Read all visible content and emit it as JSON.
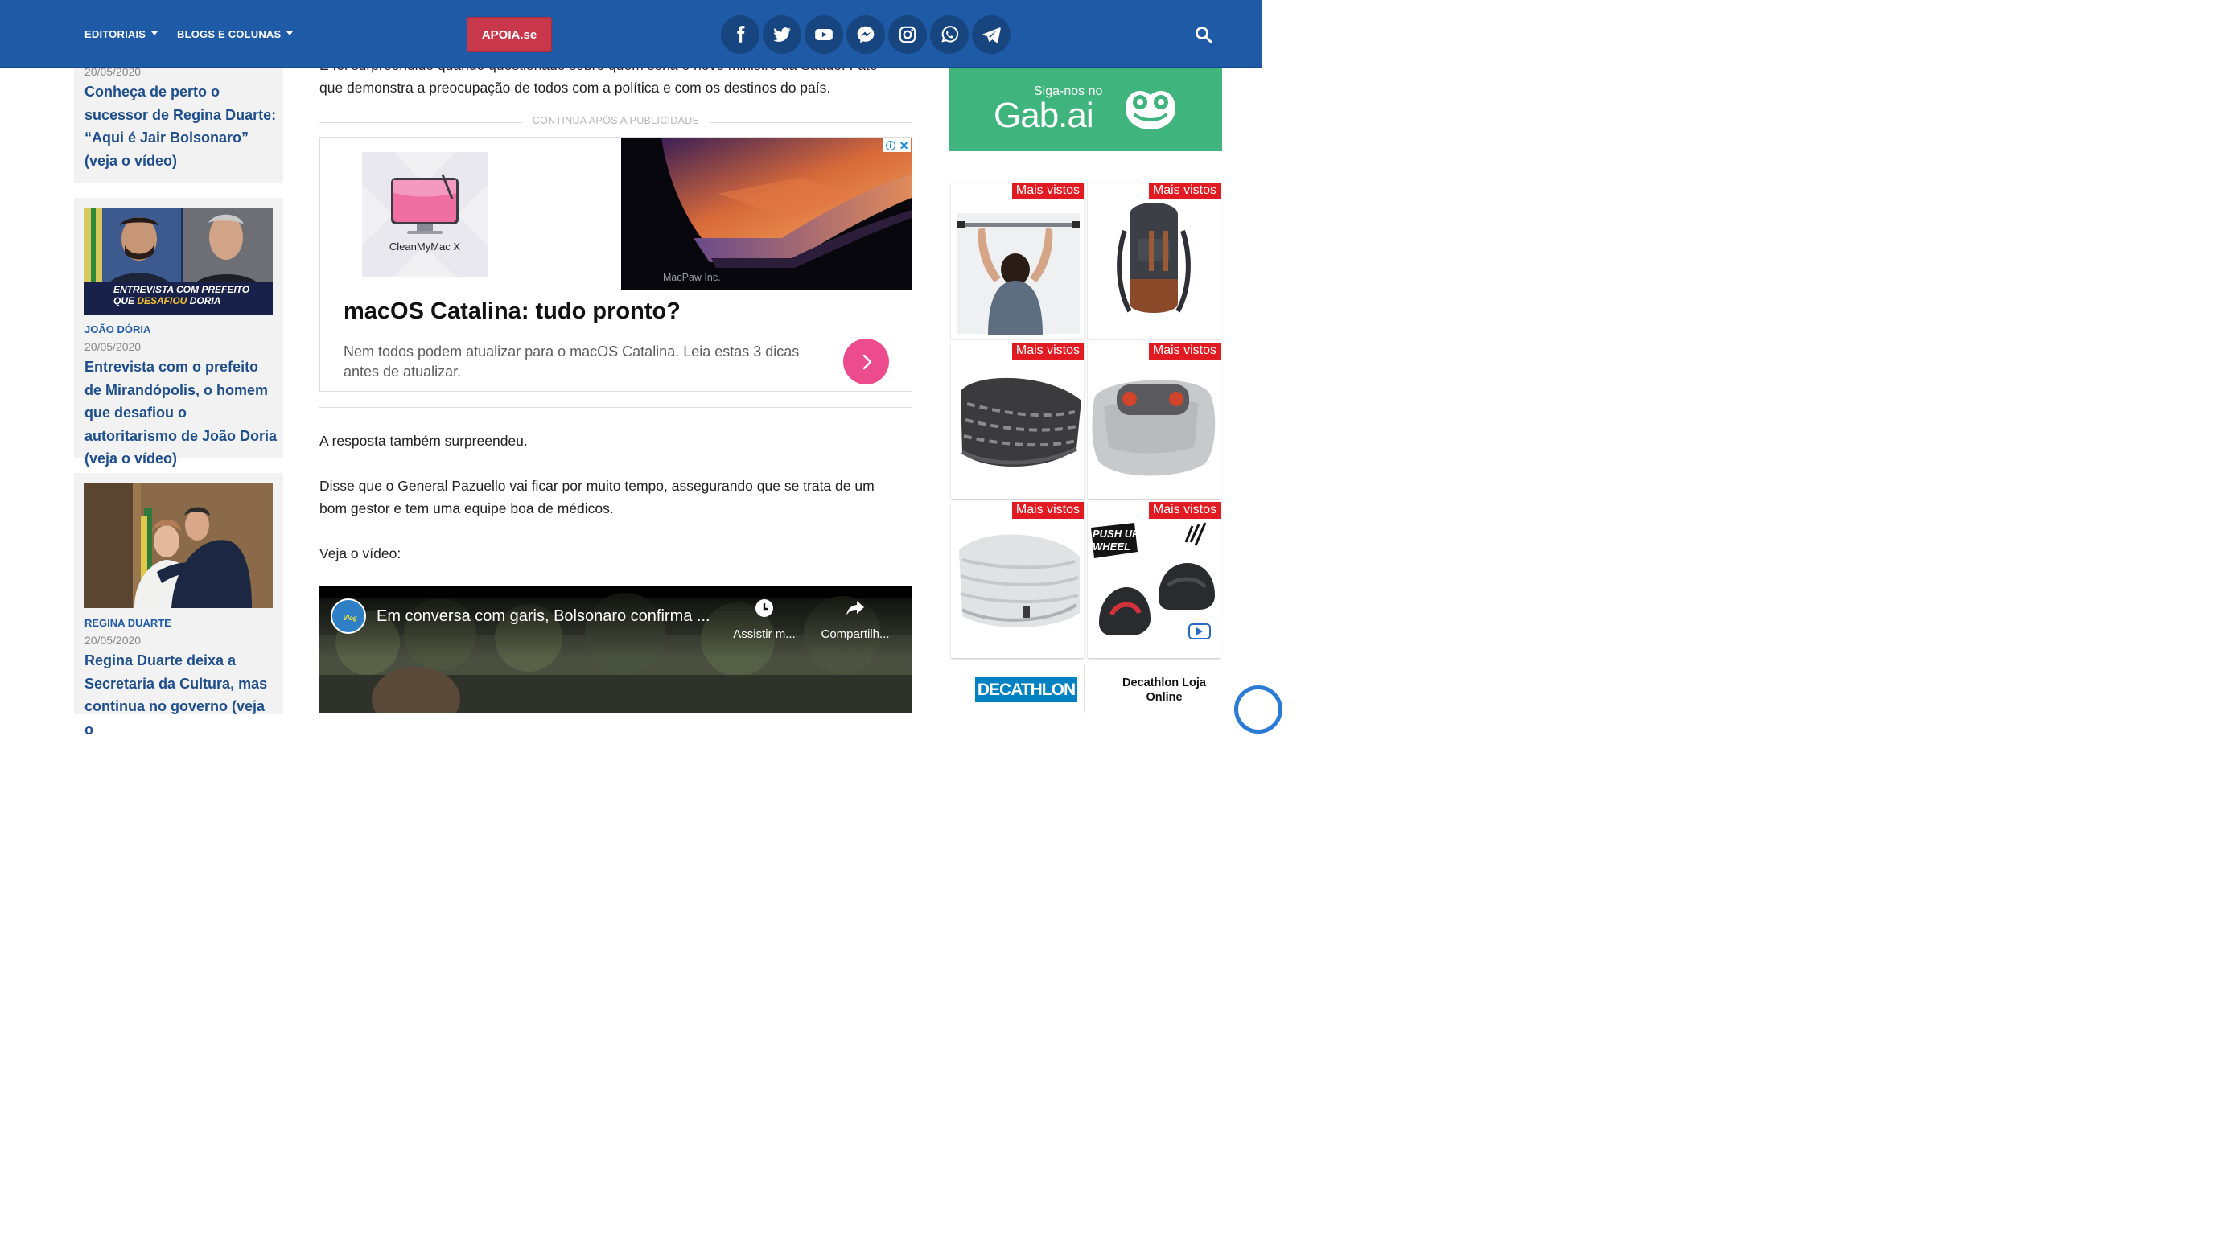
{
  "header": {
    "nav": [
      {
        "label": "EDITORIAIS"
      },
      {
        "label": "BLOGS E COLUNAS"
      }
    ],
    "cta_label": "APOIA.se",
    "social": [
      "facebook-icon",
      "twitter-icon",
      "youtube-icon",
      "messenger-icon",
      "instagram-icon",
      "whatsapp-icon",
      "telegram-icon"
    ],
    "colors": {
      "bar": "#1f5aa6",
      "cta": "#c8374a"
    }
  },
  "sidebar": {
    "cards": [
      {
        "date": "20/05/2020",
        "title": "Conheça de perto o sucessor de Regina Duarte: “Aqui é Jair Bolsonaro” (veja o vídeo)"
      },
      {
        "category": "JOÃO DÓRIA",
        "date": "20/05/2020",
        "title": "Entrevista com o prefeito de Mirandópolis, o homem que desafiou o autoritarismo de João Doria (veja o vídeo)",
        "thumb_caption_line1": "ENTREVISTA COM PREFEITO",
        "thumb_caption_line2a": "QUE ",
        "thumb_caption_line2b": "DESAFIOU",
        "thumb_caption_line2c": " DORIA"
      },
      {
        "category": "REGINA DUARTE",
        "date": "20/05/2020",
        "title": "Regina Duarte deixa a Secretaria da Cultura, mas continua no governo (veja o"
      }
    ]
  },
  "article": {
    "partial_line": "E foi surpreendido quando questionado sobre quem seria o novo ministro da Saúde. Fato",
    "para1_end": "que demonstra a preocupação de todos com a política e com os destinos do país.",
    "continua_label": "CONTINUA APÓS A PUBLICIDADE",
    "para2": "A resposta também surpreendeu.",
    "para3": "Disse que o General Pazuello vai ficar por muito tempo, assegurando que se trata de um bom gestor e tem uma equipe boa de médicos.",
    "para4": "Veja o vídeo:"
  },
  "ad": {
    "brand_label": "CleanMyMac X",
    "photo_credit": "MacPaw Inc.",
    "headline": "macOS Catalina: tudo pronto?",
    "description": "Nem todos podem atualizar para o macOS Catalina. Leia estas 3 dicas antes de atualizar.",
    "accent": "#ec4b8d"
  },
  "video": {
    "title": "Em conversa com garis, Bolsonaro confirma ...",
    "channel_badge": "Vlog",
    "watch_later": "Assistir m...",
    "share": "Compartilh..."
  },
  "right": {
    "gab_label_small": "Siga-nos no",
    "gab_label_big": "Gab.ai",
    "tiles": [
      {
        "badge": "Mais vistos",
        "product": "pull-up-bar"
      },
      {
        "badge": "Mais vistos",
        "product": "backpack"
      },
      {
        "badge": "Mais vistos",
        "product": "neck-gaiter-dark"
      },
      {
        "badge": "Mais vistos",
        "product": "massage-cushion"
      },
      {
        "badge": "Mais vistos",
        "product": "neck-gaiter-light"
      },
      {
        "badge": "Mais vistos",
        "product": "push-up-wheel",
        "product_text": "PUSH UP WHEEL"
      }
    ],
    "decathlon_logo": "DECATHLON",
    "decathlon_name": "Decathlon Loja Online"
  }
}
